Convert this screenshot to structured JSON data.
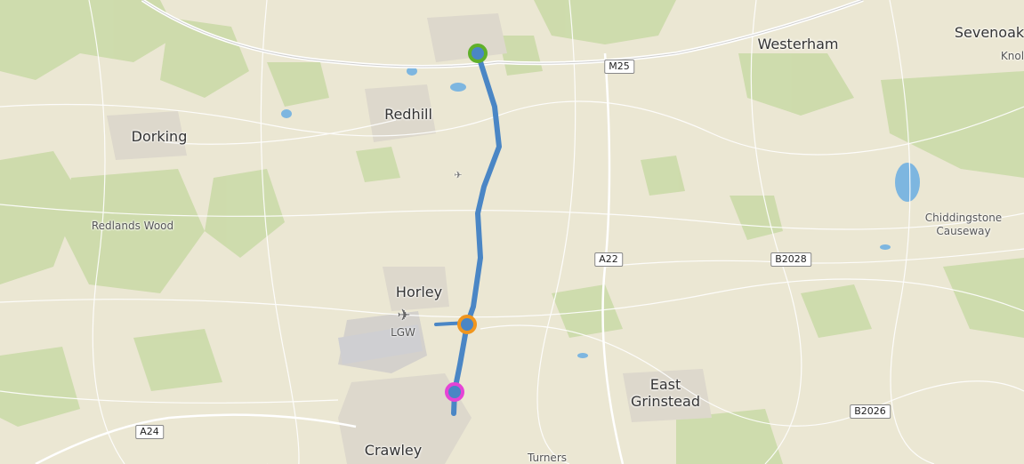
{
  "map": {
    "places": [
      {
        "key": "westerham",
        "label": "Westerham",
        "type": "town"
      },
      {
        "key": "sevenoaks",
        "label": "Sevenoak",
        "type": "town"
      },
      {
        "key": "knol",
        "label": "Knol",
        "type": "village"
      },
      {
        "key": "redhill",
        "label": "Redhill",
        "type": "town"
      },
      {
        "key": "dorking",
        "label": "Dorking",
        "type": "town"
      },
      {
        "key": "redlands",
        "label": "Redlands Wood",
        "type": "village"
      },
      {
        "key": "chiddingstone",
        "label": "Chiddingstone",
        "type": "village"
      },
      {
        "key": "causeway",
        "label": "Causeway",
        "type": "village"
      },
      {
        "key": "horley",
        "label": "Horley",
        "type": "town"
      },
      {
        "key": "east",
        "label": "East",
        "type": "town"
      },
      {
        "key": "grinstead",
        "label": "Grinstead",
        "type": "town"
      },
      {
        "key": "crawley",
        "label": "Crawley",
        "type": "town"
      },
      {
        "key": "turners",
        "label": "Turners",
        "type": "village"
      }
    ],
    "roads": {
      "m25": "M25",
      "a22": "A22",
      "b2028": "B2028",
      "b2026": "B2026",
      "a24": "A24"
    },
    "airport": {
      "code": "LGW",
      "icon": "airplane-icon"
    },
    "route": {
      "color": "#4a86c5",
      "markers": [
        {
          "key": "start",
          "color": "#5fb02a"
        },
        {
          "key": "waypoint",
          "color": "#f0961e"
        },
        {
          "key": "end",
          "color": "#e544d6"
        }
      ]
    }
  }
}
